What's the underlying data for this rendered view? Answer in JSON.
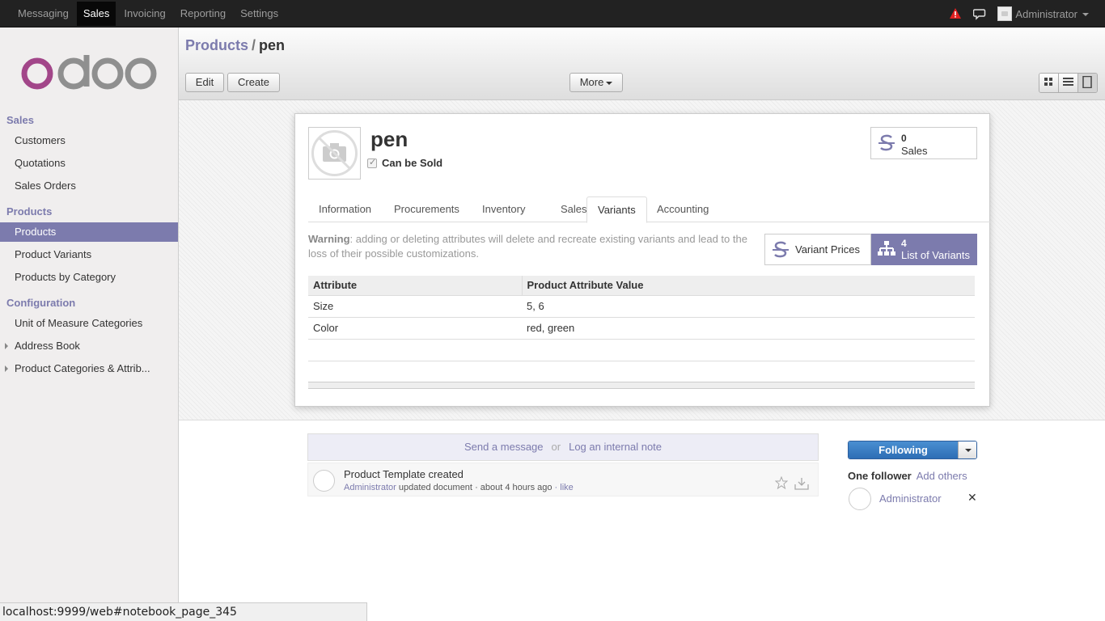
{
  "topbar": {
    "menu": [
      "Messaging",
      "Sales",
      "Invoicing",
      "Reporting",
      "Settings"
    ],
    "active_menu": "Sales",
    "user": "Administrator"
  },
  "sidebar": {
    "logo_text": "odoo",
    "sections": [
      {
        "title": "Sales",
        "items": [
          "Customers",
          "Quotations",
          "Sales Orders"
        ]
      },
      {
        "title": "Products",
        "items": [
          "Products",
          "Product Variants",
          "Products by Category"
        ]
      },
      {
        "title": "Configuration",
        "items": [
          "Unit of Measure Categories",
          "Address Book",
          "Product Categories & Attrib..."
        ]
      }
    ],
    "active_item": "Products"
  },
  "control": {
    "breadcrumb_link": "Products",
    "breadcrumb_sep": "/",
    "breadcrumb_current": "pen",
    "edit_label": "Edit",
    "create_label": "Create",
    "more_label": "More"
  },
  "form": {
    "name": "pen",
    "can_be_sold_label": "Can be Sold",
    "can_be_sold": true,
    "sales_count": "0",
    "sales_label": "Sales",
    "tabs": [
      "Information",
      "Procurements",
      "Inventory",
      "Sales",
      "Variants",
      "Accounting"
    ],
    "active_tab": "Variants",
    "warning_title": "Warning",
    "warning_text": ": adding or deleting attributes will delete and recreate existing variants and lead to the loss of their possible customizations.",
    "variant_prices_label": "Variant Prices",
    "variants_count": "4",
    "variants_label": "List of Variants",
    "table": {
      "headers": [
        "Attribute",
        "Product Attribute Value"
      ],
      "rows": [
        [
          "Size",
          "5, 6"
        ],
        [
          "Color",
          "red, green"
        ]
      ]
    }
  },
  "chatter": {
    "send_message": "Send a message",
    "or": "or",
    "log_note": "Log an internal note",
    "message_title": "Product Template created",
    "message_author": "Administrator",
    "message_action": "updated document",
    "message_time": "about 4 hours ago",
    "message_like": "like",
    "following_label": "Following",
    "followers_title": "One follower",
    "add_others": "Add others",
    "follower_name": "Administrator",
    "remove_symbol": "✕"
  },
  "statusbar": {
    "url": "localhost:9999/web#notebook_page_345"
  },
  "colors": {
    "accent": "#7c7bad",
    "topbar": "#222222",
    "follow_button": "#2d6eb5"
  }
}
